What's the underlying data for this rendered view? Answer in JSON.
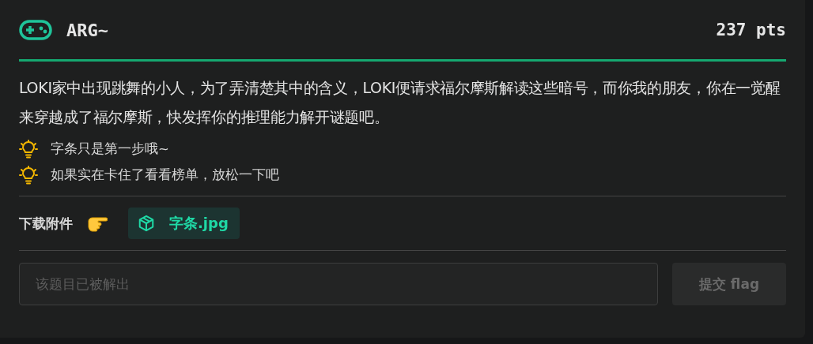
{
  "challenge": {
    "title": "ARG~",
    "points": "237 pts",
    "description": "LOKI家中出现跳舞的小人，为了弄清楚其中的含义，LOKI便请求福尔摩斯解读这些暗号，而你我的朋友，你在一觉醒来穿越成了福尔摩斯，快发挥你的推理能力解开谜题吧。"
  },
  "hints": [
    {
      "text": "字条只是第一步哦~"
    },
    {
      "text": "如果实在卡住了看看榜单，放松一下吧"
    }
  ],
  "attachments": {
    "label": "下载附件",
    "files": [
      {
        "name": "字条.jpg"
      }
    ]
  },
  "submit": {
    "placeholder": "该题目已被解出",
    "button": "提交 flag",
    "disabled": true
  }
}
